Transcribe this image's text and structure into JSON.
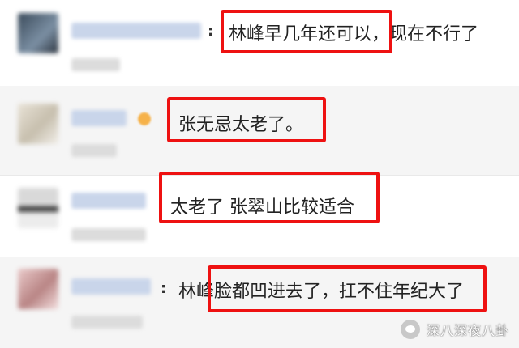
{
  "comments": [
    {
      "separator": ":",
      "text": "林峰早几年还可以，现在不行了"
    },
    {
      "separator": "",
      "text": "张无忌太老了。"
    },
    {
      "separator": ":",
      "text": "太老了 张翠山比较适合"
    },
    {
      "separator": ":",
      "text": "林峰脸都凹进去了，扛不住年纪大了"
    }
  ],
  "watermark": {
    "text": "深八深夜八卦"
  },
  "colors": {
    "highlight": "#ee1111",
    "username": "#4a6fb5"
  }
}
